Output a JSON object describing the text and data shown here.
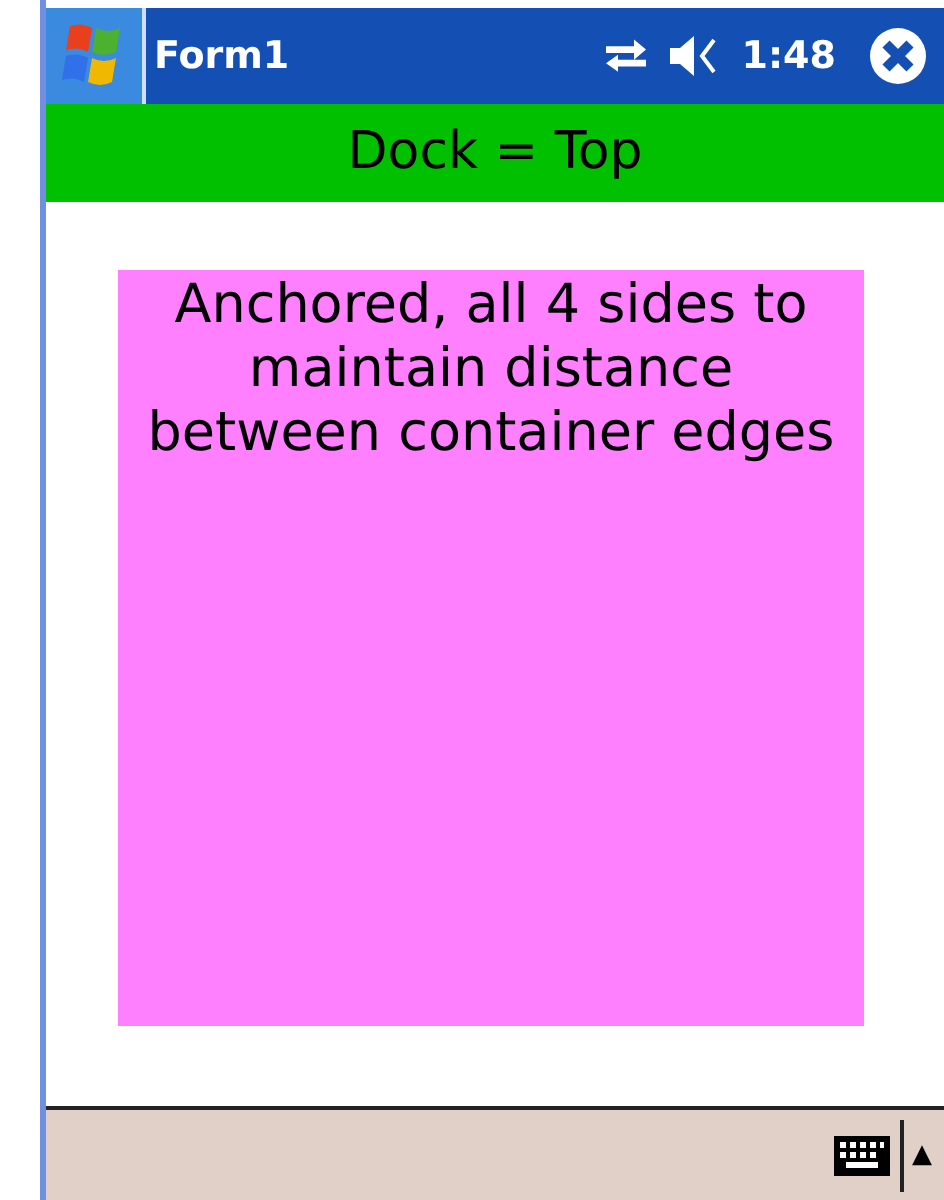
{
  "window": {
    "title": "Form1",
    "time": "1:48"
  },
  "dock_panel": {
    "text": "Dock = Top"
  },
  "anchored_panel": {
    "text": "Anchored, all 4 sides to maintain distance between container edges"
  },
  "menu_bar": {
    "arrow": "▲"
  }
}
